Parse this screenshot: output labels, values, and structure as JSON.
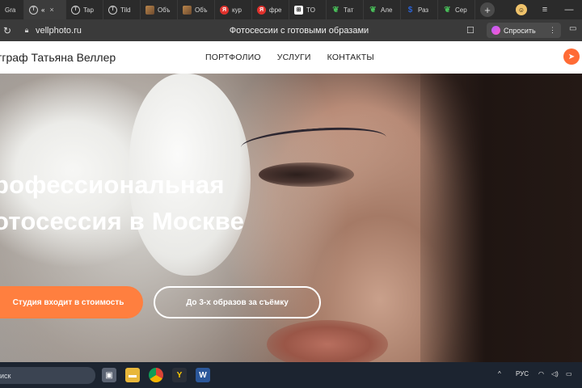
{
  "browser": {
    "tabs": [
      {
        "label": "Gra",
        "icon": "none",
        "active": false
      },
      {
        "label": "«",
        "icon": "circle-t-icon",
        "active": true
      },
      {
        "label": "Tap",
        "icon": "circle-t-icon",
        "active": false
      },
      {
        "label": "Tild",
        "icon": "circle-t-icon",
        "active": false
      },
      {
        "label": "Объ",
        "icon": "image-icon",
        "active": false
      },
      {
        "label": "Объ",
        "icon": "image-icon",
        "active": false
      },
      {
        "label": "кур",
        "icon": "yandex-icon",
        "active": false
      },
      {
        "label": "фре",
        "icon": "yandex-icon",
        "active": false
      },
      {
        "label": "TO",
        "icon": "grid-icon",
        "active": false
      },
      {
        "label": "Тат",
        "icon": "leaf-icon",
        "active": false
      },
      {
        "label": "Але",
        "icon": "leaf-icon",
        "active": false
      },
      {
        "label": "Раз",
        "icon": "blue-logo-icon",
        "active": false
      },
      {
        "label": "Сер",
        "icon": "leaf-icon",
        "active": false
      }
    ],
    "tab_close_glyph": "×",
    "new_tab_glyph": "+",
    "url": "vellphoto.ru",
    "page_title": "Фотосессии с готовыми образами",
    "ask_button": "Спросить"
  },
  "site": {
    "logo": "тграф Татьяна Веллер",
    "nav": {
      "portfolio": "ПОРТФОЛИО",
      "services": "УСЛУГИ",
      "contacts": "КОНТАКТЫ"
    },
    "accent_color": "#ff7f3f"
  },
  "hero": {
    "title_line1": "рофессиональная",
    "title_line2": "отосессия в Москве",
    "cta_primary": "Студия входит в стоимость",
    "cta_secondary": "До 3-х образов за съёмку"
  },
  "taskbar": {
    "search_placeholder": "иск",
    "language": "РУС"
  }
}
